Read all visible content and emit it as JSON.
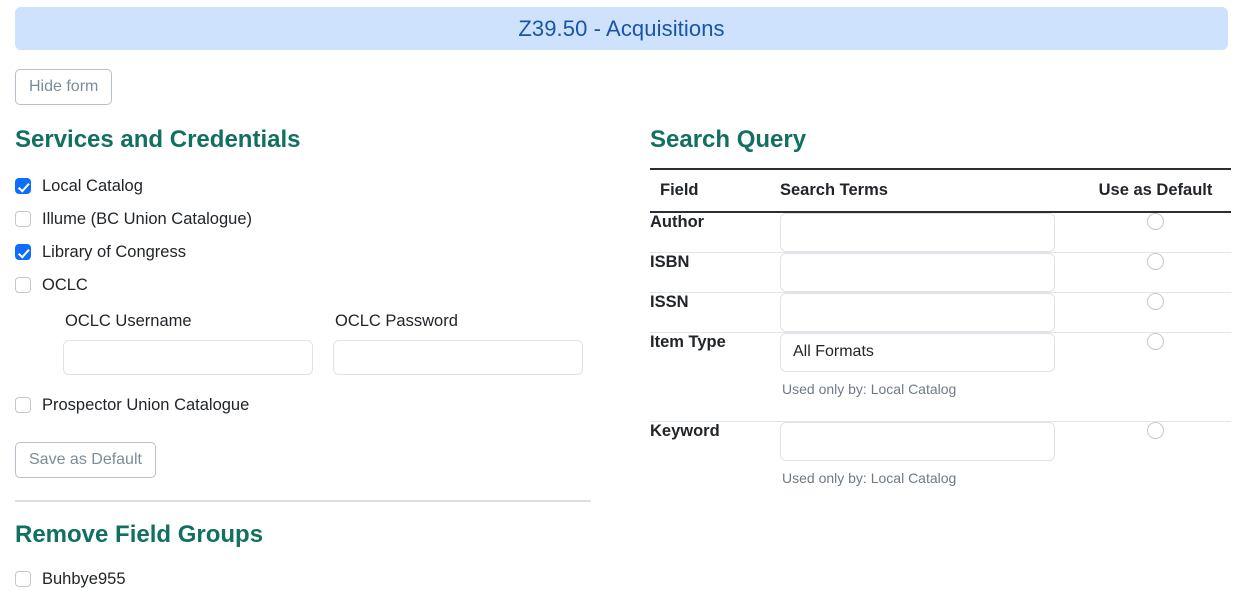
{
  "banner": {
    "title": "Z39.50 - Acquisitions"
  },
  "toolbar": {
    "hide_form_label": "Hide form",
    "save_default_label": "Save as Default"
  },
  "services": {
    "heading": "Services and Credentials",
    "items": [
      {
        "label": "Local Catalog",
        "checked": true
      },
      {
        "label": "Illume (BC Union Catalogue)",
        "checked": false
      },
      {
        "label": "Library of Congress",
        "checked": true
      },
      {
        "label": "OCLC",
        "checked": false
      }
    ],
    "credentials": [
      {
        "label": "OCLC Username",
        "value": "",
        "placeholder": ""
      },
      {
        "label": "OCLC Password",
        "value": "",
        "placeholder": ""
      }
    ],
    "prospector": {
      "label": "Prospector Union Catalogue",
      "checked": false
    }
  },
  "remove_field_groups": {
    "heading": "Remove Field Groups",
    "items": [
      {
        "label": "Buhbye955",
        "checked": false
      }
    ]
  },
  "search_query": {
    "heading": "Search Query",
    "columns": {
      "field": "Field",
      "terms": "Search Terms",
      "default": "Use as Default"
    },
    "rows": [
      {
        "field": "Author",
        "value": "",
        "placeholder": "",
        "hint": "",
        "default_selected": false
      },
      {
        "field": "ISBN",
        "value": "",
        "placeholder": "",
        "hint": "",
        "default_selected": false
      },
      {
        "field": "ISSN",
        "value": "",
        "placeholder": "",
        "hint": "",
        "default_selected": false
      },
      {
        "field": "Item Type",
        "value": "All Formats",
        "placeholder": "",
        "hint": "Used only by: Local Catalog",
        "default_selected": false
      },
      {
        "field": "Keyword",
        "value": "",
        "placeholder": "",
        "hint": "Used only by: Local Catalog",
        "default_selected": false
      }
    ]
  },
  "colors": {
    "banner_bg": "#cfe2fd",
    "banner_text": "#1854a8",
    "heading_green": "#11705f",
    "checkbox_blue": "#0d6efd",
    "muted_text": "#6e7a86"
  }
}
